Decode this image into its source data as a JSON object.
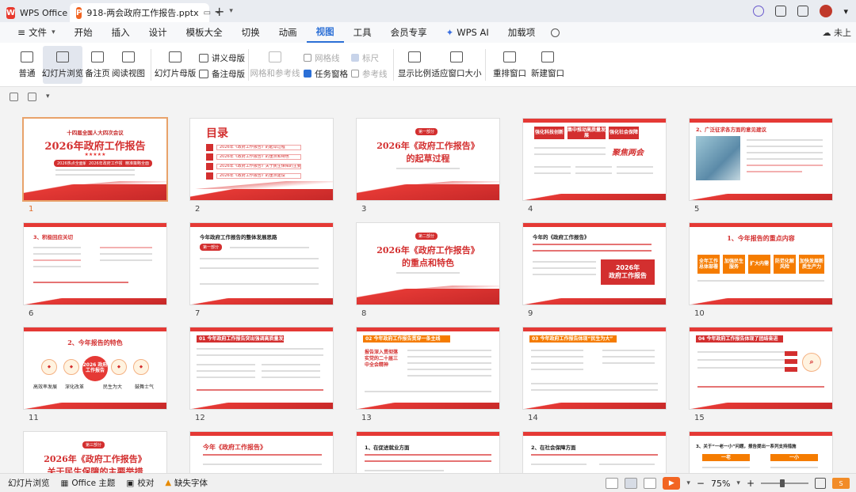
{
  "tabs": {
    "home_label": "WPS Office",
    "doc_label": "918-两会政府工作报告.pptx"
  },
  "menu": {
    "file": "文件",
    "items": [
      "开始",
      "插入",
      "设计",
      "模板大全",
      "切换",
      "动画",
      "视图",
      "工具",
      "会员专享",
      "WPS AI",
      "加载项"
    ],
    "active": "视图",
    "cloud": "未上"
  },
  "ribbon": {
    "normal": "普通",
    "slide_sorter": "幻灯片浏览",
    "notes_page": "备注页",
    "reading_view": "阅读视图",
    "slide_master": "幻灯片母版",
    "handout_master": "讲义母版",
    "notes_master": "备注母版",
    "grid_guides": "网格和参考线",
    "gridlines": "网格线",
    "ruler": "标尺",
    "task_pane": "任务窗格",
    "guides": "参考线",
    "zoom": "显示比例",
    "fit_window": "适应窗口大小",
    "arrange": "重排窗口",
    "new_window": "新建窗口"
  },
  "slides": {
    "s1": {
      "line1": "十四届全国人大四次会议",
      "title": "2026年政府工作报告",
      "stars": "★★★★★",
      "pill1": "2026热点全面解读",
      "pill2": "2026年政府工作报告",
      "pill3": "精准策略全面"
    },
    "s2": {
      "title": "目录",
      "items": [
        "2026年《政府工作报告》的起草过程",
        "2026年《政府工作报告》的重点和特色",
        "2026年《政府工作报告》关于民生保障的主要举措",
        "2026年《政府工作报告》的重点建设"
      ]
    },
    "s3": {
      "part": "第一部分",
      "title1": "2026年《政府工作报告》",
      "title2": "的起草过程"
    },
    "s4": {
      "box1": "强化科技创新",
      "box2": "集中推动高质量发展",
      "box3": "强化社会保障",
      "logo": "聚焦两会"
    },
    "s5": {
      "heading": "2、广泛征求各方面的意见建议"
    },
    "s6": {
      "heading": "3、积极回应关切"
    },
    "s7": {
      "heading": "今年政府工作报告的整体发展思路",
      "tag": "第一部分"
    },
    "s8": {
      "part": "第二部分",
      "title1": "2026年《政府工作报告》",
      "title2": "的重点和特色"
    },
    "s9": {
      "heading": "今年的《政府工作报告》",
      "banner1": "2026年",
      "banner2": "政府工作报告"
    },
    "s10": {
      "title": "1、今年报告的重点内容",
      "boxes": [
        "全年工作总体部署",
        "加强民生服务",
        "扩大内需",
        "防范化解风险",
        "加快发展新质生产力"
      ]
    },
    "s11": {
      "title": "2、今年报告的特色",
      "center": "2026 政府工作报告",
      "items": [
        "高效率发展",
        "深化改革",
        "民生为大",
        "鼓舞士气"
      ]
    },
    "s12": {
      "heading": "01 今年政府工作报告突出强调高质量发展"
    },
    "s13": {
      "heading": "02 今年政府工作报告贯穿一条主线",
      "box": "报告深入贯彻落实党的二十届三中全会精神"
    },
    "s14": {
      "heading": "03 今年政府工作报告体现“民生为大”"
    },
    "s15": {
      "heading": "04 今年政府工作报告体现了团结奋进"
    },
    "s16": {
      "part": "第三部分",
      "title1": "2026年《政府工作报告》",
      "title2": "关于民生保障的主要举措"
    },
    "s17": {
      "heading": "今年《政府工作报告》"
    },
    "s18": {
      "heading": "1、在促进就业方面"
    },
    "s19": {
      "heading": "2、在社会保障方面"
    },
    "s20": {
      "heading": "3、关于“一老一小”问题，报告提出一系列支持措施",
      "tag1": "一老",
      "tag2": "一小"
    }
  },
  "slide_numbers": [
    "1",
    "2",
    "3",
    "4",
    "5",
    "6",
    "7",
    "8",
    "9",
    "10",
    "11",
    "12",
    "13",
    "14",
    "15"
  ],
  "status": {
    "view": "幻灯片浏览",
    "theme": "Office 主题",
    "proof": "校对",
    "missing_font": "缺失字体",
    "zoom": "75%",
    "zoom_fraction": 0.45
  }
}
